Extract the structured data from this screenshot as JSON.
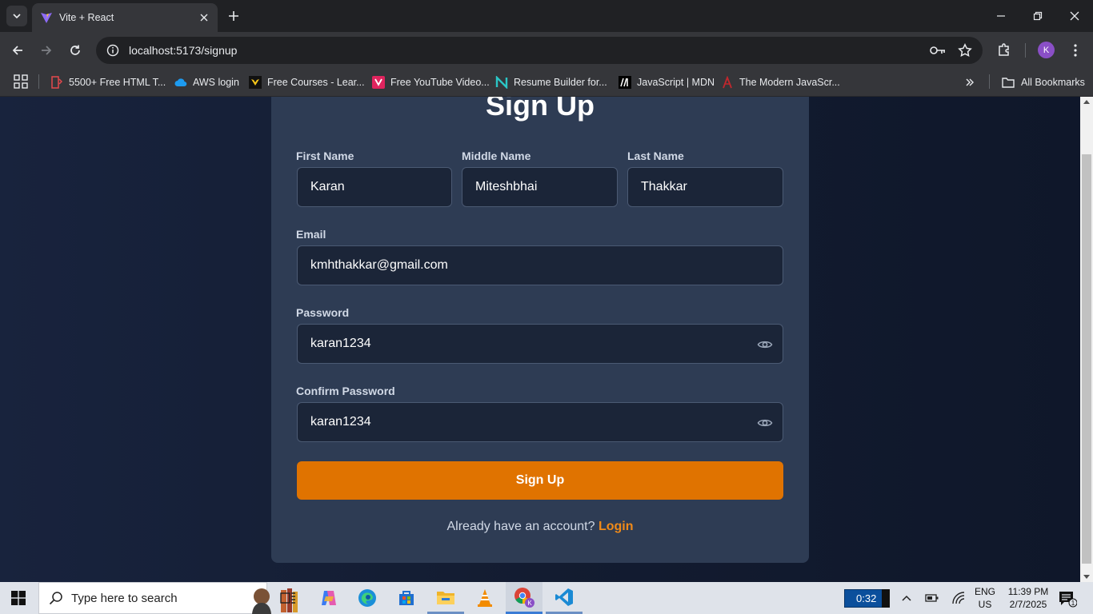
{
  "browser": {
    "tab_title": "Vite + React",
    "url": "localhost:5173/signup",
    "profile_initial": "K",
    "bookmarks": [
      {
        "label": "5500+ Free HTML T...",
        "icon": "html-template-icon"
      },
      {
        "label": "AWS login",
        "icon": "aws-cloud-icon"
      },
      {
        "label": "Free Courses - Lear...",
        "icon": "courses-icon"
      },
      {
        "label": "Free YouTube Video...",
        "icon": "video-icon"
      },
      {
        "label": "Resume Builder for...",
        "icon": "resume-icon"
      },
      {
        "label": "JavaScript | MDN",
        "icon": "mdn-icon"
      },
      {
        "label": "The Modern JavaScr...",
        "icon": "modern-js-icon"
      }
    ],
    "all_bookmarks_label": "All Bookmarks"
  },
  "form": {
    "title": "Sign Up",
    "first_name_label": "First Name",
    "first_name_value": "Karan",
    "middle_name_label": "Middle Name",
    "middle_name_value": "Miteshbhai",
    "last_name_label": "Last Name",
    "last_name_value": "Thakkar",
    "email_label": "Email",
    "email_value": "kmhthakkar@gmail.com",
    "password_label": "Password",
    "password_value": "karan1234",
    "confirm_password_label": "Confirm Password",
    "confirm_password_value": "karan1234",
    "submit_label": "Sign Up",
    "footer_prompt": "Already have an account?",
    "login_link": "Login"
  },
  "taskbar": {
    "search_placeholder": "Type here to search",
    "timer": "0:32",
    "language": "ENG",
    "region": "US",
    "time": "11:39 PM",
    "date": "2/7/2025",
    "notification_count": "1"
  },
  "colors": {
    "accent": "#e07300",
    "card": "#2e3c54",
    "background": "#111a2e"
  }
}
